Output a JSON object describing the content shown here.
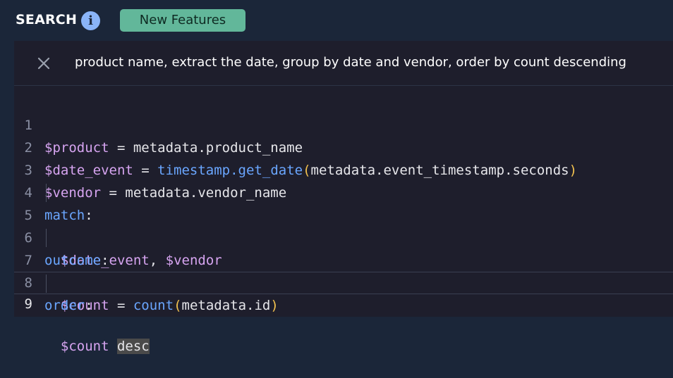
{
  "header": {
    "title": "SEARCH",
    "info_icon": "info-icon",
    "badge_label": "New Features",
    "badge_color": "#62b79a"
  },
  "query": {
    "text": "product name, extract the date, group by date and vendor, order by count descending",
    "close_icon": "close-icon"
  },
  "editor": {
    "lines": [
      {
        "number": "1",
        "tokens": [
          "$product",
          " = metadata.product_name"
        ]
      },
      {
        "number": "2",
        "tokens": [
          "$date_event",
          " = ",
          "timestamp.get_date",
          "(",
          "metadata.event_timestamp.seconds",
          ")"
        ]
      },
      {
        "number": "3",
        "tokens": [
          "$vendor",
          " = metadata.vendor_name"
        ]
      },
      {
        "number": "4",
        "tokens": [
          "match",
          ":"
        ]
      },
      {
        "number": "5",
        "tokens": [
          "$date_event",
          ", ",
          "$vendor"
        ]
      },
      {
        "number": "6",
        "tokens": [
          "outcome",
          ":"
        ]
      },
      {
        "number": "7",
        "tokens": [
          "$count",
          " = ",
          "count",
          "(",
          "metadata.id",
          ")"
        ]
      },
      {
        "number": "8",
        "tokens": [
          "order",
          ":"
        ]
      },
      {
        "number": "9",
        "tokens": [
          "$count",
          " ",
          "desc"
        ]
      }
    ],
    "active_line": "9"
  }
}
